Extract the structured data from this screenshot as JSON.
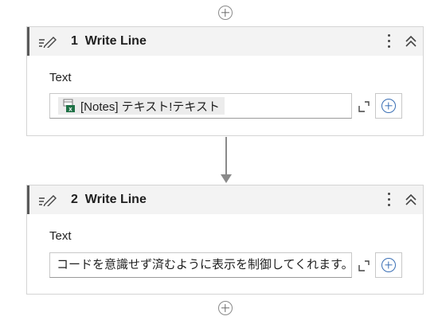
{
  "activities": [
    {
      "number": "1",
      "title": "Write Line",
      "field_label": "Text",
      "value_type": "variable",
      "value": "[Notes] テキスト!テキスト",
      "value_icon": "excel-icon"
    },
    {
      "number": "2",
      "title": "Write Line",
      "field_label": "Text",
      "value_type": "text",
      "value": "コードを意識せず済むように表示を制御してくれます。",
      "value_icon": ""
    }
  ],
  "icons": {
    "activity": "write-line-icon",
    "menu": "more-vertical-icon",
    "collapse": "chevron-up-double-icon",
    "expand": "expand-editor-icon",
    "add": "add-circle-icon"
  },
  "colors": {
    "header_bg": "#f3f3f3",
    "accent_border": "#5a5a5a",
    "add_field_blue": "#3a6fb5",
    "excel_green": "#1e7145"
  }
}
